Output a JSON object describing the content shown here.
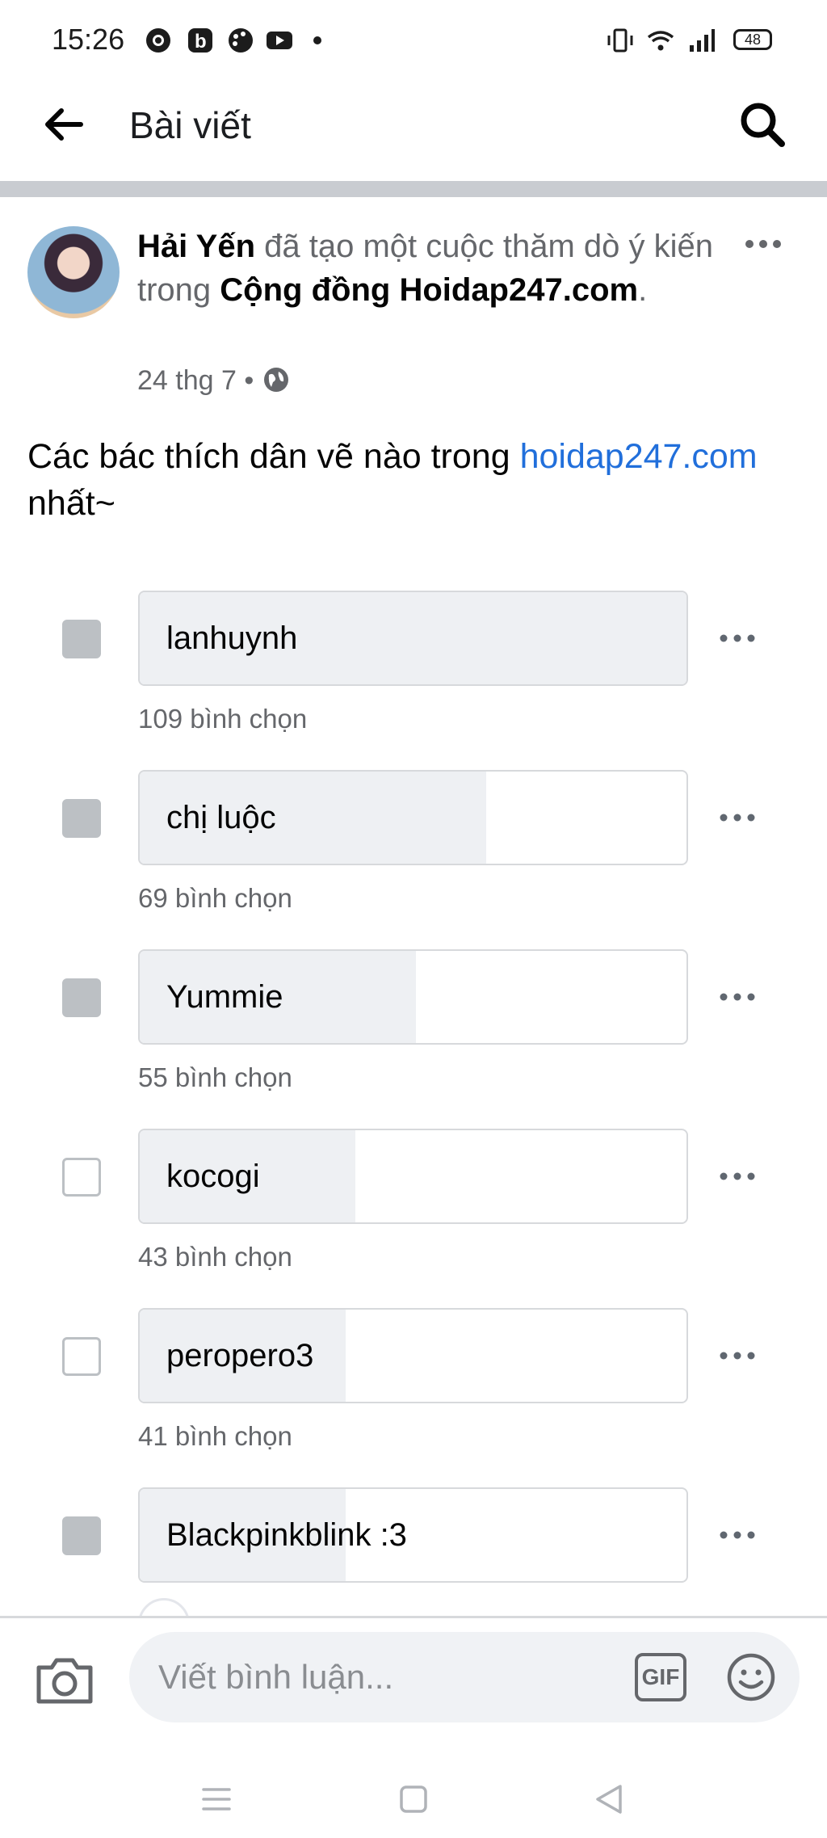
{
  "status_bar": {
    "time": "15:26",
    "battery": "48"
  },
  "app_bar": {
    "title": "Bài viết"
  },
  "post": {
    "author": "Hải Yến",
    "action_text": "đã tạo một cuộc thăm dò ý kiến trong",
    "group": "Cộng đồng Hoidap247.com",
    "end": ".",
    "date": "24 thg 7",
    "separator": "•",
    "text_before": "Các bác thích dân vẽ nào trong ",
    "text_link": "hoidap247.com",
    "text_after": "nhất~"
  },
  "poll": {
    "options": [
      {
        "label": "lanhuynh",
        "votes_text": "109 bình chọn",
        "votes": 109,
        "checked": true
      },
      {
        "label": "chị luộc",
        "votes_text": "69 bình chọn",
        "votes": 69,
        "checked": true
      },
      {
        "label": "Yummie",
        "votes_text": "55 bình chọn",
        "votes": 55,
        "checked": true
      },
      {
        "label": "kocogi",
        "votes_text": "43 bình chọn",
        "votes": 43,
        "checked": false
      },
      {
        "label": "peropero3",
        "votes_text": "41 bình chọn",
        "votes": 41,
        "checked": false
      },
      {
        "label": "Blackpinkblink :3",
        "votes_text": "",
        "votes": 41,
        "checked": true
      }
    ]
  },
  "composer": {
    "placeholder": "Viết bình luận...",
    "gif": "GIF"
  },
  "icons": {
    "back": "arrow-left-icon",
    "search": "search-icon",
    "more": "more-horizontal-icon",
    "globe": "globe-icon",
    "camera": "camera-icon",
    "emoji": "emoji-icon"
  },
  "colors": {
    "link": "#216fdb",
    "check": "#bcc0c4",
    "fill": "#eef0f3"
  }
}
